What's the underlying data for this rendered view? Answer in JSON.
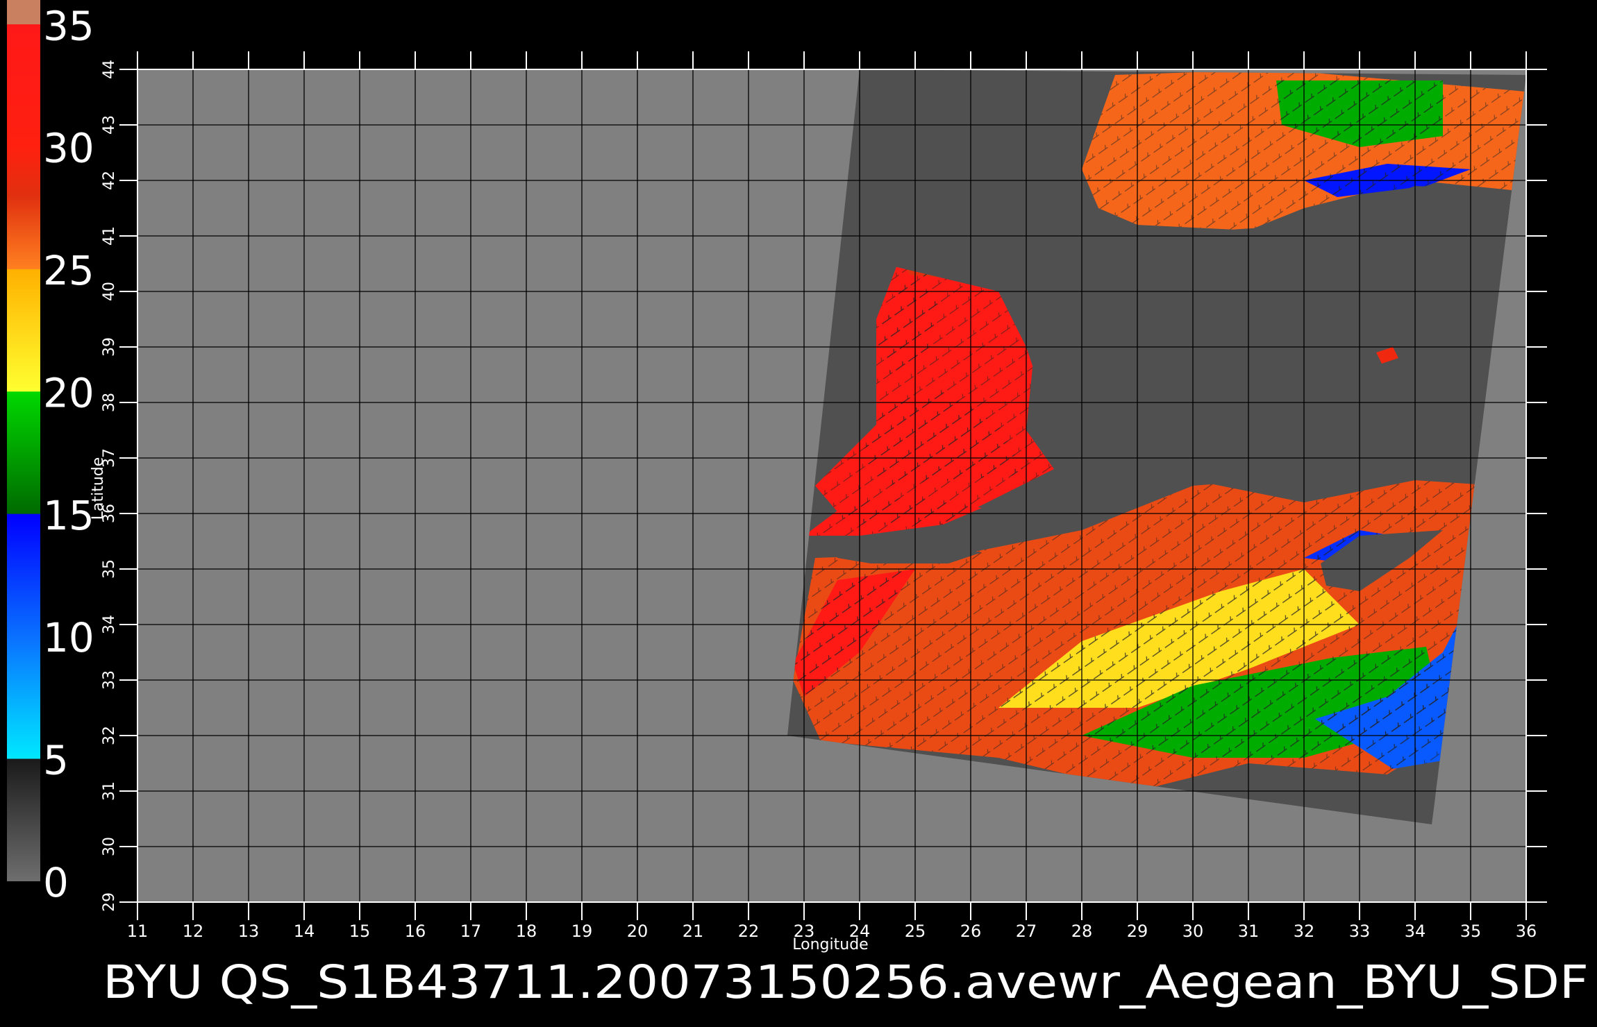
{
  "colorbar": {
    "ticks": [
      {
        "value": 35,
        "label": "35"
      },
      {
        "value": 30,
        "label": "30"
      },
      {
        "value": 25,
        "label": "25"
      },
      {
        "value": 20,
        "label": "20"
      },
      {
        "value": 15,
        "label": "15"
      },
      {
        "value": 10,
        "label": "10"
      },
      {
        "value": 5,
        "label": "5"
      },
      {
        "value": 0,
        "label": "0"
      }
    ],
    "range": [
      0,
      36
    ],
    "stops": [
      {
        "value": 0,
        "color": "#6e6e6e"
      },
      {
        "value": 5,
        "color": "#1a1a1a"
      },
      {
        "value": 5.01,
        "color": "#00e8ff"
      },
      {
        "value": 10,
        "color": "#0a70ff"
      },
      {
        "value": 15,
        "color": "#0000ff"
      },
      {
        "value": 15.01,
        "color": "#006a00"
      },
      {
        "value": 20,
        "color": "#00d800"
      },
      {
        "value": 20.01,
        "color": "#ffff30"
      },
      {
        "value": 25,
        "color": "#ffb000"
      },
      {
        "value": 25.01,
        "color": "#ff8020"
      },
      {
        "value": 28,
        "color": "#e03010"
      },
      {
        "value": 30,
        "color": "#ff2010"
      },
      {
        "value": 35,
        "color": "#ff1818"
      },
      {
        "value": 35.01,
        "color": "#c88060"
      },
      {
        "value": 36,
        "color": "#c88060"
      }
    ]
  },
  "map": {
    "xlabel": "Longitude",
    "ylabel": "Latitude",
    "lon_range": [
      11,
      36
    ],
    "lat_range": [
      29,
      44
    ],
    "lon_ticks": [
      "11",
      "12",
      "13",
      "14",
      "15",
      "16",
      "17",
      "18",
      "19",
      "20",
      "21",
      "22",
      "23",
      "24",
      "25",
      "26",
      "27",
      "28",
      "29",
      "30",
      "31",
      "32",
      "33",
      "34",
      "35",
      "36"
    ],
    "lat_ticks": [
      "29",
      "30",
      "31",
      "32",
      "33",
      "34",
      "35",
      "36",
      "37",
      "38",
      "39",
      "40",
      "41",
      "42",
      "43",
      "44"
    ],
    "grid": true,
    "background_color": "#808080",
    "swath_color": "#505050",
    "grid_color": "#000000",
    "swath_corners": [
      [
        24.0,
        44.0
      ],
      [
        36.0,
        43.9
      ],
      [
        34.3,
        30.4
      ],
      [
        22.7,
        32.0
      ]
    ],
    "regions": [
      {
        "name": "black-sea-coast",
        "speed": 26,
        "points": [
          [
            28.0,
            42.2
          ],
          [
            28.6,
            43.9
          ],
          [
            31.5,
            44
          ],
          [
            36,
            43.6
          ],
          [
            36,
            41.8
          ],
          [
            34,
            42.0
          ],
          [
            32,
            41.5
          ],
          [
            31,
            41.1
          ],
          [
            29,
            41.2
          ],
          [
            28.3,
            41.5
          ]
        ]
      },
      {
        "name": "black-sea-east-low",
        "speed": 14,
        "points": [
          [
            32.0,
            42.0
          ],
          [
            33.5,
            42.3
          ],
          [
            35.0,
            42.2
          ],
          [
            34.2,
            41.9
          ],
          [
            32.6,
            41.7
          ]
        ]
      },
      {
        "name": "black-sea-north-green",
        "speed": 18,
        "points": [
          [
            31.5,
            43.8
          ],
          [
            34.5,
            43.8
          ],
          [
            34.5,
            42.8
          ],
          [
            33,
            42.6
          ],
          [
            31.6,
            43.0
          ]
        ]
      },
      {
        "name": "aegean-west",
        "speed": 33,
        "points": [
          [
            23.2,
            36.5
          ],
          [
            24.3,
            37.6
          ],
          [
            24.3,
            39.5
          ],
          [
            24.8,
            40.8
          ],
          [
            26.5,
            40.5
          ],
          [
            27.2,
            39.5
          ],
          [
            27,
            37.5
          ],
          [
            27.5,
            36.8
          ],
          [
            25.5,
            35.8
          ],
          [
            23.8,
            35.8
          ]
        ]
      },
      {
        "name": "aegean-north",
        "speed": 28,
        "points": [
          [
            24.6,
            40.9
          ],
          [
            26.5,
            40.9
          ],
          [
            27.6,
            40.9
          ],
          [
            28.5,
            40.6
          ],
          [
            27.8,
            40.4
          ],
          [
            26.0,
            40.2
          ],
          [
            24.9,
            40.3
          ]
        ]
      },
      {
        "name": "levantine-basin",
        "speed": 27,
        "points": [
          [
            22.8,
            33.0
          ],
          [
            23.2,
            35.2
          ],
          [
            26,
            35.3
          ],
          [
            28,
            35.7
          ],
          [
            30.0,
            36.5
          ],
          [
            32.5,
            36.7
          ],
          [
            35.5,
            36.5
          ],
          [
            36,
            35.4
          ],
          [
            35.2,
            33.5
          ],
          [
            34.6,
            32.0
          ],
          [
            33.5,
            31.3
          ],
          [
            31.0,
            31.5
          ],
          [
            29.0,
            31.0
          ],
          [
            26.5,
            31.6
          ],
          [
            23.3,
            31.9
          ]
        ]
      },
      {
        "name": "levantine-mid-yellow",
        "speed": 22,
        "points": [
          [
            26.5,
            32.5
          ],
          [
            28,
            33.7
          ],
          [
            30.5,
            34.6
          ],
          [
            32,
            35.0
          ],
          [
            33.0,
            34.0
          ],
          [
            31,
            33.2
          ],
          [
            29,
            32.5
          ]
        ]
      },
      {
        "name": "levantine-green",
        "speed": 18,
        "points": [
          [
            28,
            32.0
          ],
          [
            30,
            32.9
          ],
          [
            32.5,
            33.4
          ],
          [
            34.2,
            33.6
          ],
          [
            34.5,
            32.3
          ],
          [
            32.0,
            31.6
          ],
          [
            30.0,
            31.6
          ]
        ]
      },
      {
        "name": "levantine-east-blue",
        "speed": 11,
        "points": [
          [
            32.2,
            32.3
          ],
          [
            33.5,
            32.7
          ],
          [
            34.5,
            33.5
          ],
          [
            35.6,
            35.6
          ],
          [
            35.6,
            34.0
          ],
          [
            35.3,
            32.5
          ],
          [
            34.8,
            31.6
          ],
          [
            33.6,
            31.4
          ]
        ]
      },
      {
        "name": "cyprus-west-blue",
        "speed": 13,
        "points": [
          [
            32.0,
            35.2
          ],
          [
            33.0,
            35.7
          ],
          [
            33.6,
            35.6
          ],
          [
            32.8,
            35.1
          ]
        ]
      },
      {
        "name": "crete-west-purple",
        "speed": 33.5,
        "points": [
          [
            23.0,
            35.6
          ],
          [
            23.8,
            36.2
          ],
          [
            25.0,
            36.3
          ],
          [
            26.2,
            36.1
          ],
          [
            25.5,
            35.8
          ],
          [
            24.0,
            35.6
          ]
        ]
      },
      {
        "name": "aegean-purple",
        "speed": 33.5,
        "points": [
          [
            24.0,
            37.0
          ],
          [
            24.5,
            38.0
          ],
          [
            25.5,
            38.2
          ],
          [
            26.5,
            37.6
          ],
          [
            27.0,
            36.7
          ],
          [
            25.6,
            36.6
          ],
          [
            24.5,
            36.5
          ]
        ]
      },
      {
        "name": "sw-purple",
        "speed": 33.5,
        "points": [
          [
            22.8,
            33.3
          ],
          [
            23.6,
            34.8
          ],
          [
            25.0,
            35.0
          ],
          [
            24.0,
            33.5
          ],
          [
            23.0,
            32.7
          ]
        ]
      },
      {
        "name": "north-aegean-purple",
        "speed": 33.5,
        "points": [
          [
            24.3,
            39.2
          ],
          [
            24.8,
            40.3
          ],
          [
            25.5,
            39.8
          ],
          [
            25.2,
            38.8
          ],
          [
            24.5,
            38.5
          ]
        ]
      }
    ],
    "land_masks": [
      {
        "name": "turkey-anatolia",
        "points": [
          [
            24.0,
            40.6
          ],
          [
            26.5,
            40.0
          ],
          [
            27.0,
            39.0
          ],
          [
            27.5,
            37.5
          ],
          [
            28.5,
            36.7
          ],
          [
            30.0,
            36.6
          ],
          [
            32.0,
            36.2
          ],
          [
            34.0,
            36.6
          ],
          [
            35.6,
            36.8
          ],
          [
            36,
            37.0
          ],
          [
            36,
            41.8
          ],
          [
            34,
            41.9
          ],
          [
            32,
            41.2
          ],
          [
            30.5,
            41.1
          ],
          [
            29.0,
            41.0
          ],
          [
            28.2,
            41.2
          ],
          [
            26.8,
            41.4
          ],
          [
            25.5,
            40.95
          ],
          [
            24.2,
            41.0
          ]
        ]
      },
      {
        "name": "crete",
        "points": [
          [
            23.5,
            35.5
          ],
          [
            24.5,
            35.6
          ],
          [
            26.2,
            35.3
          ],
          [
            25.6,
            35.1
          ],
          [
            24.2,
            35.1
          ],
          [
            23.6,
            35.2
          ]
        ]
      },
      {
        "name": "cyprus",
        "points": [
          [
            32.3,
            35.1
          ],
          [
            33.0,
            35.6
          ],
          [
            34.5,
            35.7
          ],
          [
            33.9,
            35.2
          ],
          [
            33.0,
            34.6
          ],
          [
            32.4,
            34.7
          ]
        ]
      },
      {
        "name": "egypt-coast",
        "points": [
          [
            24.5,
            31.8
          ],
          [
            29.0,
            31.0
          ],
          [
            31.0,
            31.5
          ],
          [
            32.5,
            31.2
          ],
          [
            34.3,
            31.2
          ],
          [
            34.5,
            30.5
          ],
          [
            30,
            30.4
          ],
          [
            24.5,
            30.6
          ]
        ]
      }
    ],
    "islands": [
      {
        "name": "cyprus-small-marker",
        "speed": 29,
        "points": [
          [
            33.3,
            38.9
          ],
          [
            33.6,
            39.0
          ],
          [
            33.7,
            38.8
          ],
          [
            33.4,
            38.7
          ]
        ]
      }
    ]
  },
  "footer": {
    "title": "BYU  QS_S1B43711.20073150256.avewr_Aegean_BYU_SDF"
  }
}
